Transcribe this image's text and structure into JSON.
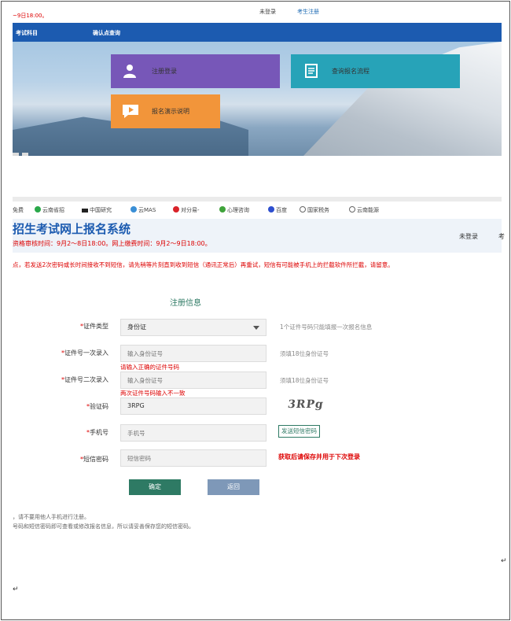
{
  "top": {
    "time": "~9日18:00。",
    "login": "未登录",
    "register": "考生注册",
    "nav": [
      "考试科目",
      "确认点查询"
    ],
    "tiles": [
      {
        "label": "注册登录",
        "color": "#7757b8"
      },
      {
        "label": "查询报名流程",
        "color": "#27a3b8"
      },
      {
        "label": "报名演示说明",
        "color": "#f2953a"
      }
    ]
  },
  "bookmarks": [
    "免费",
    "云南省招",
    "中国研究",
    "云MAS",
    "对分易-",
    "心理咨询",
    "百度",
    "国家税务",
    "云南能源"
  ],
  "header": {
    "title": "招生考试网上报名系统",
    "time_line": "资格审核时间：9月2～8日18:00。网上缴费时间：9月2～9日18:00。",
    "login": "未登录",
    "register": "考"
  },
  "notice": "点，若发送2次密码或长时间接收不到短信，请先稍等片刻直到收到短信（通讯正常后）再重试，短信有可能被手机上的拦截软件所拦截，请留意。",
  "form": {
    "title": "注册信息",
    "id_type": {
      "label": "证件类型",
      "value": "身份证",
      "hint": "1个证件号码只能填报一次报名信息"
    },
    "id_first": {
      "label": "证件号一次录入",
      "placeholder": "输入身份证号",
      "hint": "须填18位身份证号",
      "error": "请输入正确的证件号码"
    },
    "id_second": {
      "label": "证件号二次录入",
      "placeholder": "输入身份证号",
      "hint": "须填18位身份证号",
      "error": "两次证件号码输入不一致"
    },
    "captcha": {
      "label": "验证码",
      "value": "3RPG",
      "image_text": "3RPg"
    },
    "phone": {
      "label": "手机号",
      "placeholder": "手机号",
      "button": "发送短信密码"
    },
    "sms": {
      "label": "短信密码",
      "placeholder": "短信密码",
      "tip": "获取后请保存并用于下次登录"
    },
    "ok": "确定",
    "back": "返回",
    "required_mark": "*"
  },
  "footer": [
    "，请不要用他人手机进行注册。",
    "号码和短信密码即可查看或修改报名信息，所以请妥善保存您的短信密码。"
  ],
  "marks": {
    "para1": "↵",
    "para2": "↵"
  }
}
